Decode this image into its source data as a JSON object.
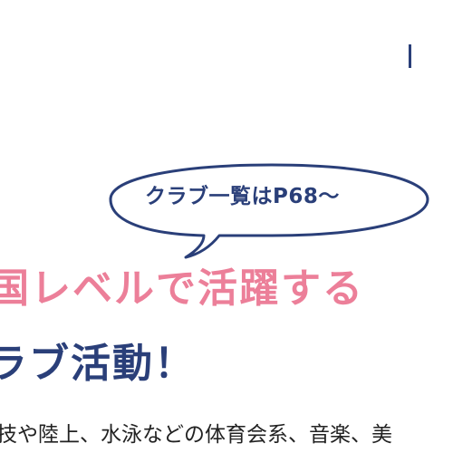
{
  "bubble": {
    "text": "クラブ一覧はP68～"
  },
  "headline": {
    "line1": "国レベルで活躍する",
    "line2": "ラブ活動！"
  },
  "body": {
    "text": "技や陸上、水泳などの体育会系、音楽、美"
  },
  "colors": {
    "navy": "#2a3f79",
    "pink": "#ec7f99",
    "text": "#222222"
  }
}
